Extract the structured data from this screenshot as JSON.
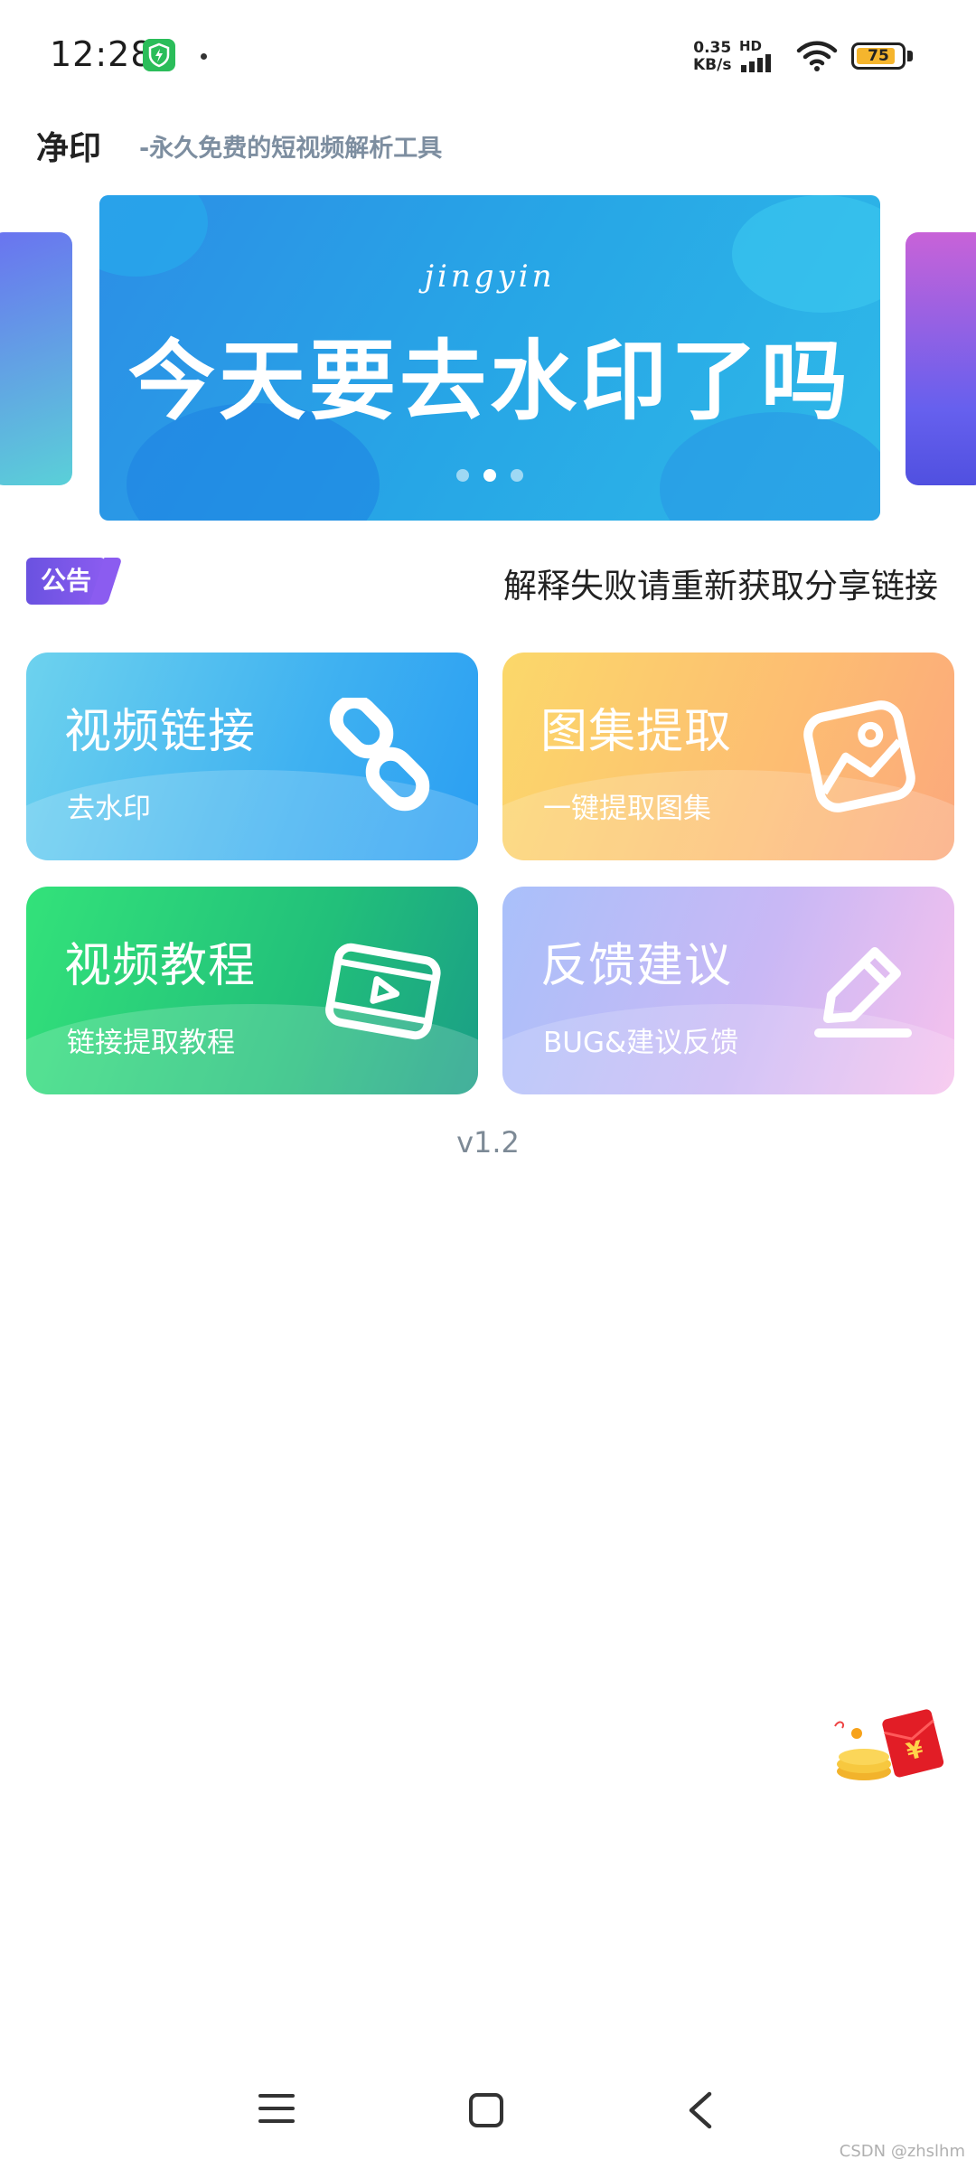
{
  "status_bar": {
    "time": "12:28",
    "net_speed_value": "0.35",
    "net_speed_unit": "KB/s",
    "network_type": "HD",
    "battery_level": "75"
  },
  "header": {
    "title": "净印",
    "subtitle": "-永久免费的短视频解析工具"
  },
  "banner": {
    "pinyin": "jingyin",
    "headline": "今天要去水印了吗",
    "page_count": 3,
    "active_index": 1
  },
  "notice": {
    "badge": "公告",
    "text": "解释失败请重新获取分享链接"
  },
  "cards": [
    {
      "title": "视频链接",
      "subtitle": "去水印",
      "icon": "link-icon"
    },
    {
      "title": "图集提取",
      "subtitle": "一键提取图集",
      "icon": "image-icon"
    },
    {
      "title": "视频教程",
      "subtitle": "链接提取教程",
      "icon": "video-icon"
    },
    {
      "title": "反馈建议",
      "subtitle": "BUG&建议反馈",
      "icon": "edit-icon"
    }
  ],
  "version": "v1.2",
  "floating_button": {
    "icon": "red-envelope-icon",
    "symbol": "¥"
  },
  "watermark": "CSDN @zhslhm",
  "colors": {
    "notice_badge": "#7b57ea",
    "card_link": "#3fb1f1",
    "card_gallery": "#fdbd72",
    "card_tutorial": "#22c07a",
    "card_feedback": "#c9b8f5"
  }
}
